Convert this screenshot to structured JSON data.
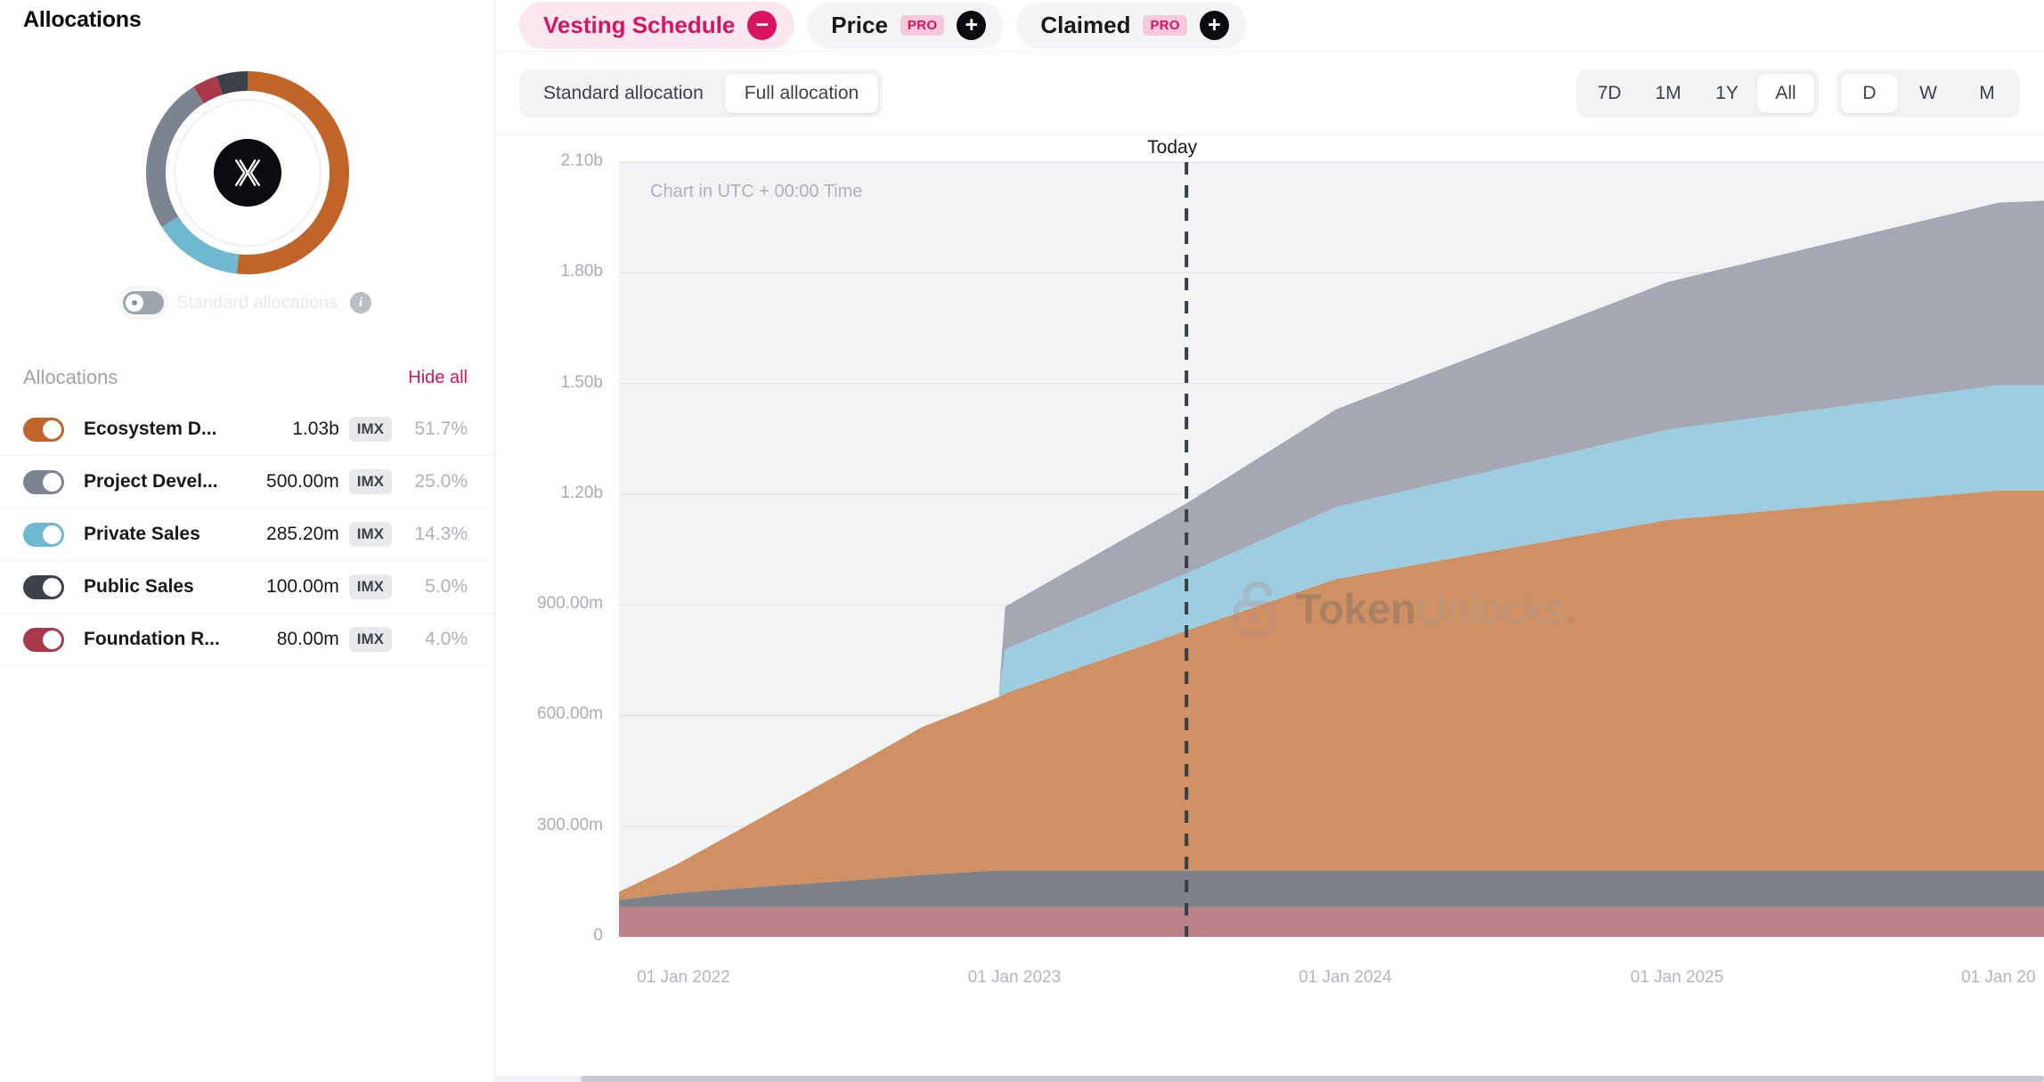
{
  "sidebar": {
    "title": "Allocations",
    "standard_toggle": {
      "label": "Standard allocations",
      "info_icon": "info-icon",
      "state": "off"
    },
    "list_header": {
      "label": "Allocations",
      "hide_all": "Hide all"
    },
    "rows": [
      {
        "name": "Ecosystem D...",
        "amount": "1.03b",
        "symbol": "IMX",
        "pct": "51.7%",
        "color": "#c0642a",
        "on": true
      },
      {
        "name": "Project Devel...",
        "amount": "500.00m",
        "symbol": "IMX",
        "pct": "25.0%",
        "color": "#7d838f",
        "on": true
      },
      {
        "name": "Private Sales",
        "amount": "285.20m",
        "symbol": "IMX",
        "pct": "14.3%",
        "color": "#6fb9d0",
        "on": true
      },
      {
        "name": "Public Sales",
        "amount": "100.00m",
        "symbol": "IMX",
        "pct": "5.0%",
        "color": "#3c414a",
        "on": true
      },
      {
        "name": "Foundation R...",
        "amount": "80.00m",
        "symbol": "IMX",
        "pct": "4.0%",
        "color": "#a8384a",
        "on": true
      }
    ]
  },
  "tabs": [
    {
      "label": "Vesting Schedule",
      "pro": null,
      "button": "minus-icon",
      "active": true
    },
    {
      "label": "Price",
      "pro": "PRO",
      "button": "plus-icon",
      "active": false
    },
    {
      "label": "Claimed",
      "pro": "PRO",
      "button": "plus-icon",
      "active": false
    }
  ],
  "controls": {
    "allocation_modes": [
      {
        "label": "Standard allocation",
        "selected": false
      },
      {
        "label": "Full allocation",
        "selected": true
      }
    ],
    "ranges": [
      {
        "label": "7D",
        "selected": false
      },
      {
        "label": "1M",
        "selected": false
      },
      {
        "label": "1Y",
        "selected": false
      },
      {
        "label": "All",
        "selected": true
      }
    ],
    "intervals": [
      {
        "label": "D",
        "selected": true
      },
      {
        "label": "W",
        "selected": false
      },
      {
        "label": "M",
        "selected": false
      }
    ]
  },
  "chart": {
    "today_label": "Today",
    "utc_note": "Chart in UTC + 00:00 Time",
    "watermark": {
      "bold": "Token",
      "light": "Unlocks",
      "dot": ".",
      "icon": "unlock-icon"
    }
  },
  "chart_data": {
    "type": "area",
    "title": "Vesting Schedule",
    "xlabel": "",
    "ylabel": "",
    "stacked": true,
    "grid": true,
    "legend": "sidebar",
    "ylim": [
      0,
      2100000000
    ],
    "ytick_labels": [
      "0",
      "300.00m",
      "600.00m",
      "900.00m",
      "1.20b",
      "1.50b",
      "1.80b",
      "2.10b"
    ],
    "ytick_values": [
      0,
      300000000,
      600000000,
      900000000,
      1200000000,
      1500000000,
      1800000000,
      2100000000
    ],
    "xtick_labels": [
      "01 Jan 2022",
      "01 Jan 2023",
      "01 Jan 2024",
      "01 Jan 2025",
      "01 Jan 20"
    ],
    "xtick_values": [
      "2022-01-01",
      "2023-01-01",
      "2024-01-01",
      "2025-01-01",
      "2026-01-01"
    ],
    "x_domain": [
      "2021-11-01",
      "2026-02-20"
    ],
    "today_marker": "2023-07-20",
    "x": [
      "2021-11-01",
      "2022-01-01",
      "2022-04-01",
      "2022-07-01",
      "2022-10-01",
      "2022-12-25",
      "2023-01-01",
      "2023-07-20",
      "2024-01-01",
      "2025-01-01",
      "2026-01-01",
      "2026-02-20"
    ],
    "series": [
      {
        "name": "Foundation R...",
        "color": "#bd8289",
        "values": [
          80000000,
          80000000,
          80000000,
          80000000,
          80000000,
          80000000,
          80000000,
          80000000,
          80000000,
          80000000,
          80000000,
          80000000
        ]
      },
      {
        "name": "Public Sales",
        "color": "#7d8087",
        "values": [
          20000000,
          38000000,
          55000000,
          70000000,
          88000000,
          100000000,
          100000000,
          100000000,
          100000000,
          100000000,
          100000000,
          100000000
        ]
      },
      {
        "name": "Ecosystem D...",
        "color": "#cf9063",
        "values": [
          22000000,
          75000000,
          180000000,
          290000000,
          400000000,
          470000000,
          480000000,
          650000000,
          790000000,
          950000000,
          1030000000,
          1030000000
        ]
      },
      {
        "name": "Private Sales",
        "color": "#9ccde0",
        "values": [
          0,
          0,
          0,
          0,
          0,
          0,
          120000000,
          155000000,
          195000000,
          245000000,
          285200000,
          285200000
        ]
      },
      {
        "name": "Project Devel...",
        "color": "#a5a8b3",
        "values": [
          0,
          0,
          0,
          0,
          0,
          0,
          115000000,
          190000000,
          265000000,
          400000000,
          495000000,
          500000000
        ]
      }
    ],
    "donut": {
      "type": "pie",
      "labels": [
        "Ecosystem D...",
        "Private Sales",
        "Project Devel...",
        "Foundation R...",
        "Public Sales"
      ],
      "values": [
        51.7,
        14.3,
        25.0,
        4.0,
        5.0
      ],
      "colors": [
        "#c0642a",
        "#6fb9d0",
        "#7d838f",
        "#a8384a",
        "#3c414a"
      ]
    }
  }
}
